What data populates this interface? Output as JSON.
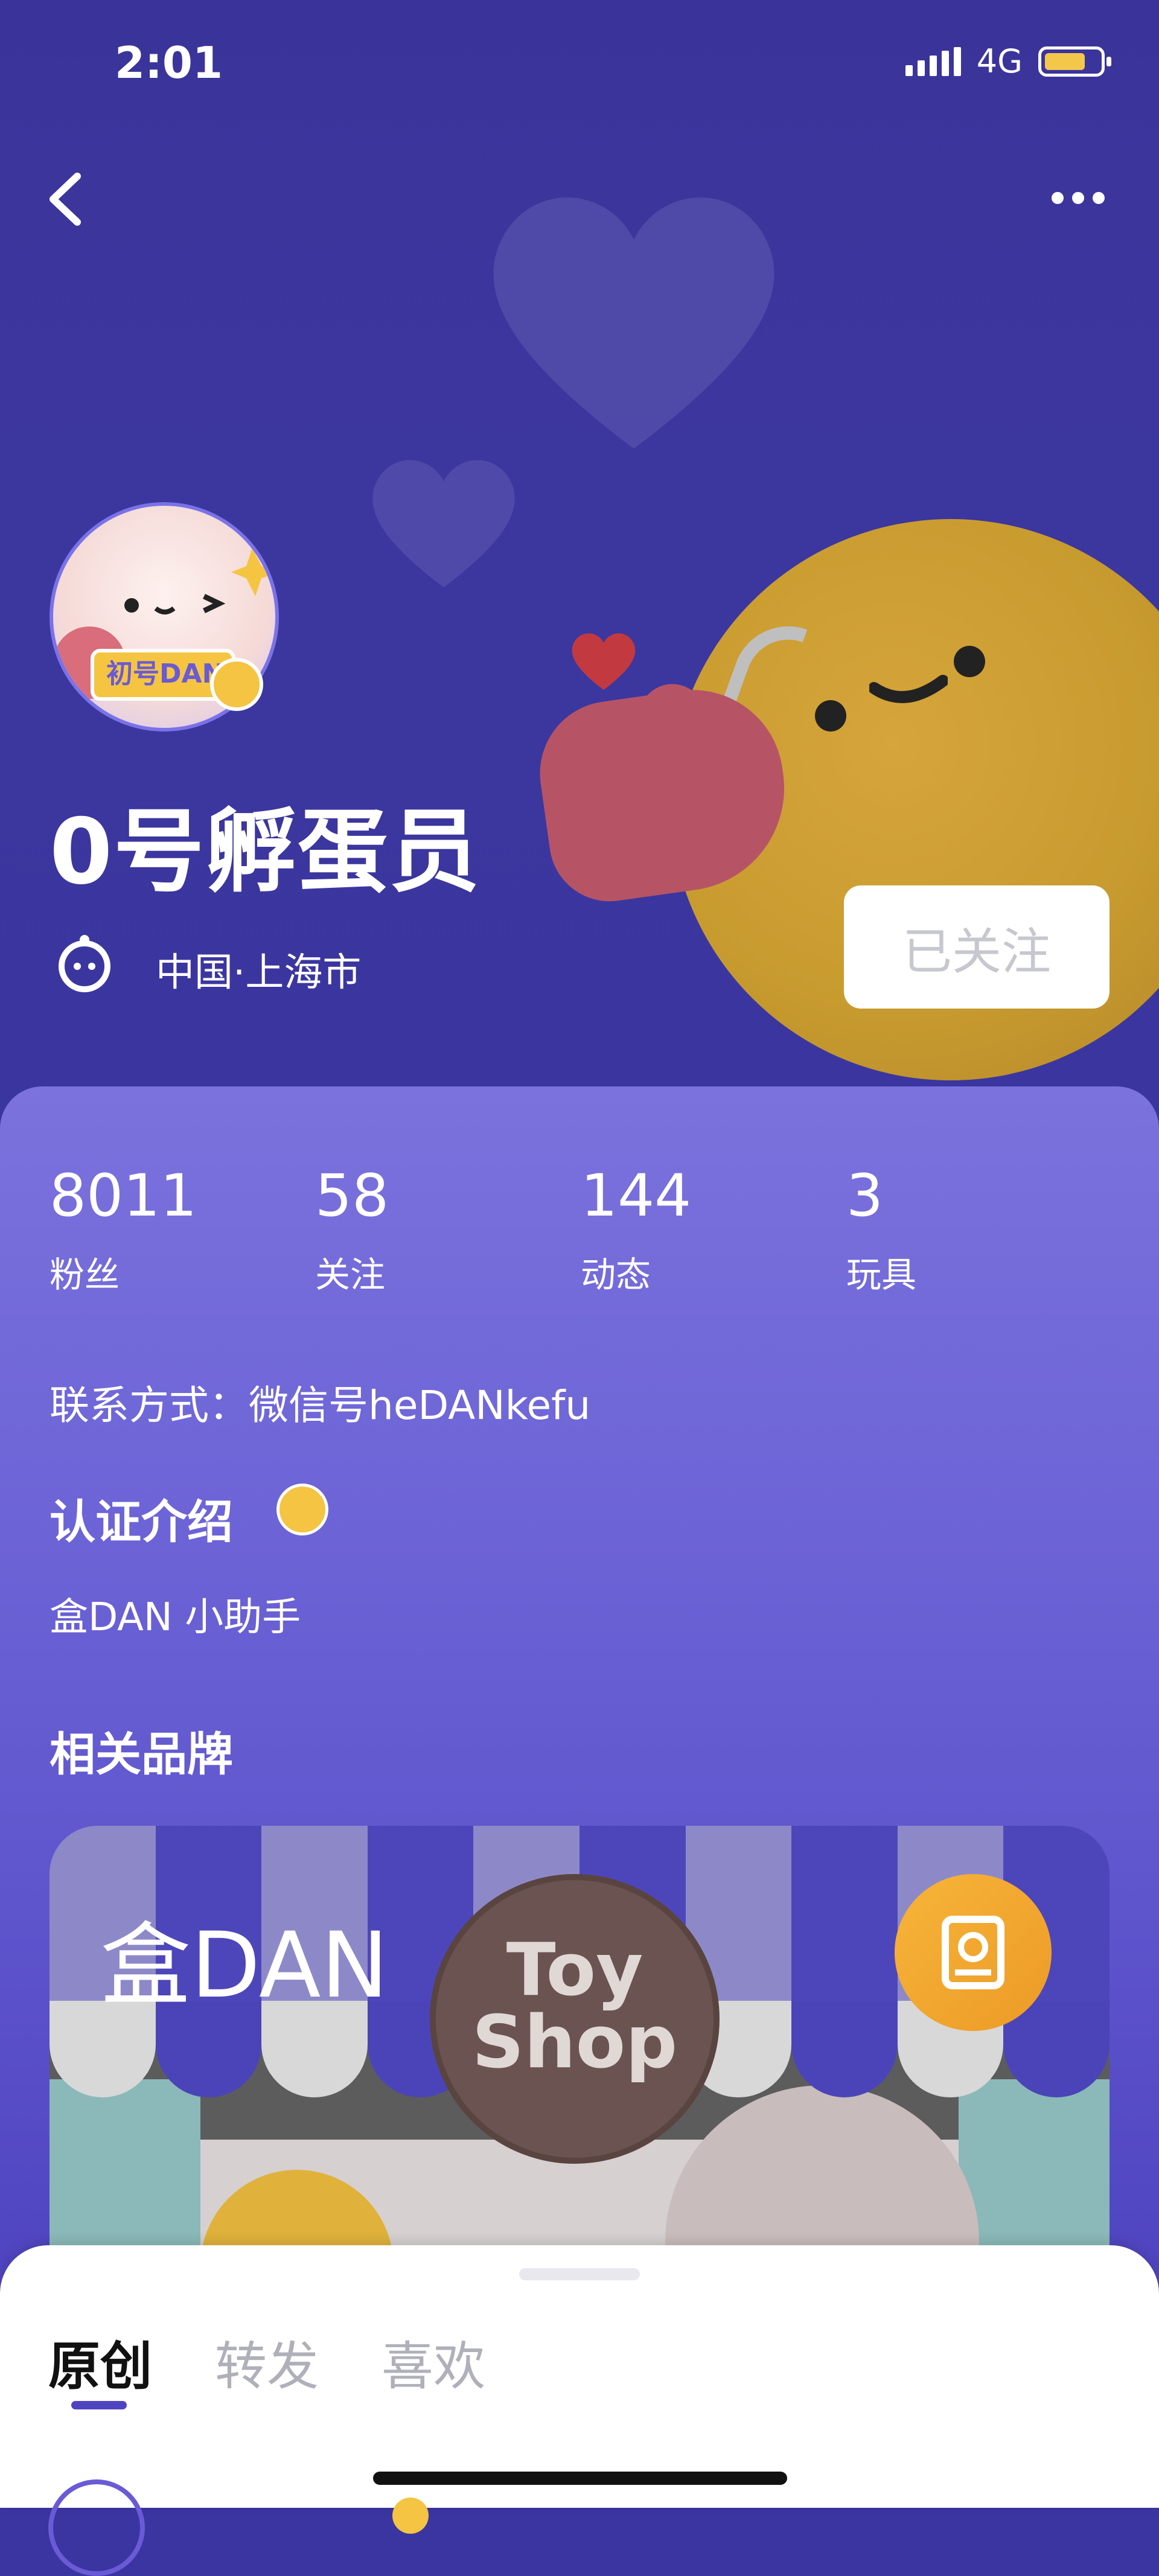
{
  "status_bar": {
    "time": "2:01",
    "network": "4G"
  },
  "profile": {
    "avatar_badge": "初号DAN",
    "name": "0号孵蛋员",
    "location": "中国·上海市",
    "follow_label": "已关注"
  },
  "stats": [
    {
      "value": "8011",
      "label": "粉丝"
    },
    {
      "value": "58",
      "label": "关注"
    },
    {
      "value": "144",
      "label": "动态"
    },
    {
      "value": "3",
      "label": "玩具"
    }
  ],
  "contact": "联系方式：微信号heDANkefu",
  "certification": {
    "title": "认证介绍",
    "description": "盒DAN 小助手"
  },
  "brands": {
    "title": "相关品牌",
    "items": [
      {
        "name": "盒DAN",
        "logo_text": "Toy Shop"
      }
    ]
  },
  "tabs": [
    {
      "label": "原创",
      "active": true
    },
    {
      "label": "转发",
      "active": false
    },
    {
      "label": "喜欢",
      "active": false
    }
  ],
  "colors": {
    "header_bg": "#3a349a",
    "card_bg": "#7b72dd",
    "accent": "#4f44c0",
    "badge_yellow": "#f4c442",
    "brand_orange": "#f0a62e"
  },
  "icons": {
    "back": "chevron-left-icon",
    "more": "more-dots-icon",
    "location": "location-pin-icon",
    "brand_book": "book-icon"
  }
}
